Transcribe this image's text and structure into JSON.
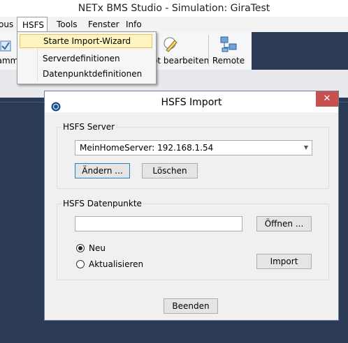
{
  "window": {
    "title": "NETx BMS Studio - Simulation: GiraTest"
  },
  "menubar": {
    "items": [
      "ous",
      "HSFS",
      "Tools",
      "Fenster",
      "Info"
    ],
    "active": "HSFS"
  },
  "hsfs_menu": {
    "items": [
      "Starte Import-Wizard",
      "Serverdefinitionen",
      "Datenpunktdefinitionen"
    ],
    "highlighted": "Starte Import-Wizard"
  },
  "toolbar": {
    "items": [
      "amm",
      "ot bearbeiten",
      "Remote"
    ],
    "icons": [
      "grid-icon",
      "edit-pencil-icon",
      "network-computers-icon"
    ]
  },
  "dialog": {
    "title": "HSFS Import",
    "close_glyph": "✕",
    "server_group": {
      "label": "HSFS Server",
      "selected_server": "MeinHomeServer: 192.168.1.54",
      "change_button": "Ändern ...",
      "delete_button": "Löschen"
    },
    "datapoints_group": {
      "label": "HSFS Datenpunkte",
      "file_path_value": "",
      "open_button": "Öffnen ...",
      "mode_options": [
        "Neu",
        "Aktualisieren"
      ],
      "selected_mode": "Neu",
      "import_button": "Import"
    },
    "exit_button": "Beenden"
  },
  "colors": {
    "accent_close": "#c75050",
    "menu_highlight": "#fdf4bf",
    "background_dark": "#2b3a55"
  }
}
